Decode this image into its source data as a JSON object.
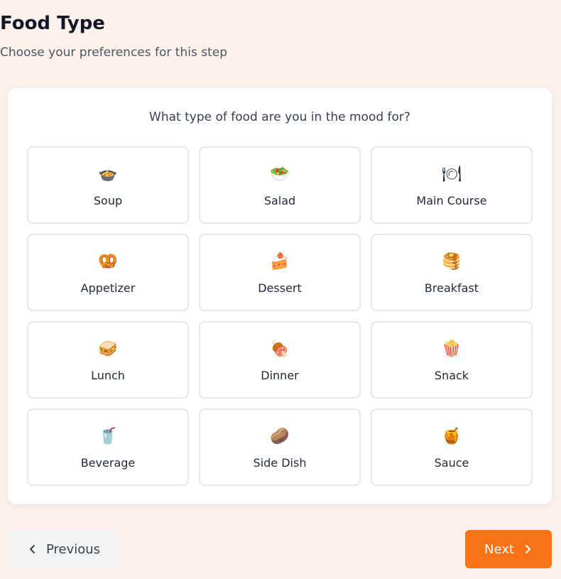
{
  "header": {
    "title": "Food Type",
    "subtitle": "Choose your preferences for this step"
  },
  "question": "What type of food are you in the mood for?",
  "options": [
    {
      "label": "Soup",
      "icon": "🍲",
      "icon_name": "soup-icon"
    },
    {
      "label": "Salad",
      "icon": "🥗",
      "icon_name": "salad-icon"
    },
    {
      "label": "Main Course",
      "icon": "🍽",
      "icon_name": "plate-icon"
    },
    {
      "label": "Appetizer",
      "icon": "🥨",
      "icon_name": "pretzel-icon"
    },
    {
      "label": "Dessert",
      "icon": "🍰",
      "icon_name": "cake-icon"
    },
    {
      "label": "Breakfast",
      "icon": "🥞",
      "icon_name": "pancakes-icon"
    },
    {
      "label": "Lunch",
      "icon": "🥪",
      "icon_name": "sandwich-icon"
    },
    {
      "label": "Dinner",
      "icon": "🍖",
      "icon_name": "meat-icon"
    },
    {
      "label": "Snack",
      "icon": "🍿",
      "icon_name": "popcorn-icon"
    },
    {
      "label": "Beverage",
      "icon": "🥤",
      "icon_name": "cup-icon"
    },
    {
      "label": "Side Dish",
      "icon": "🥔",
      "icon_name": "potato-icon"
    },
    {
      "label": "Sauce",
      "icon": "🍯",
      "icon_name": "sauce-pot-icon"
    }
  ],
  "nav": {
    "previous_label": "Previous",
    "next_label": "Next"
  },
  "colors": {
    "accent": "#f97316",
    "background": "#fdf1ec"
  }
}
